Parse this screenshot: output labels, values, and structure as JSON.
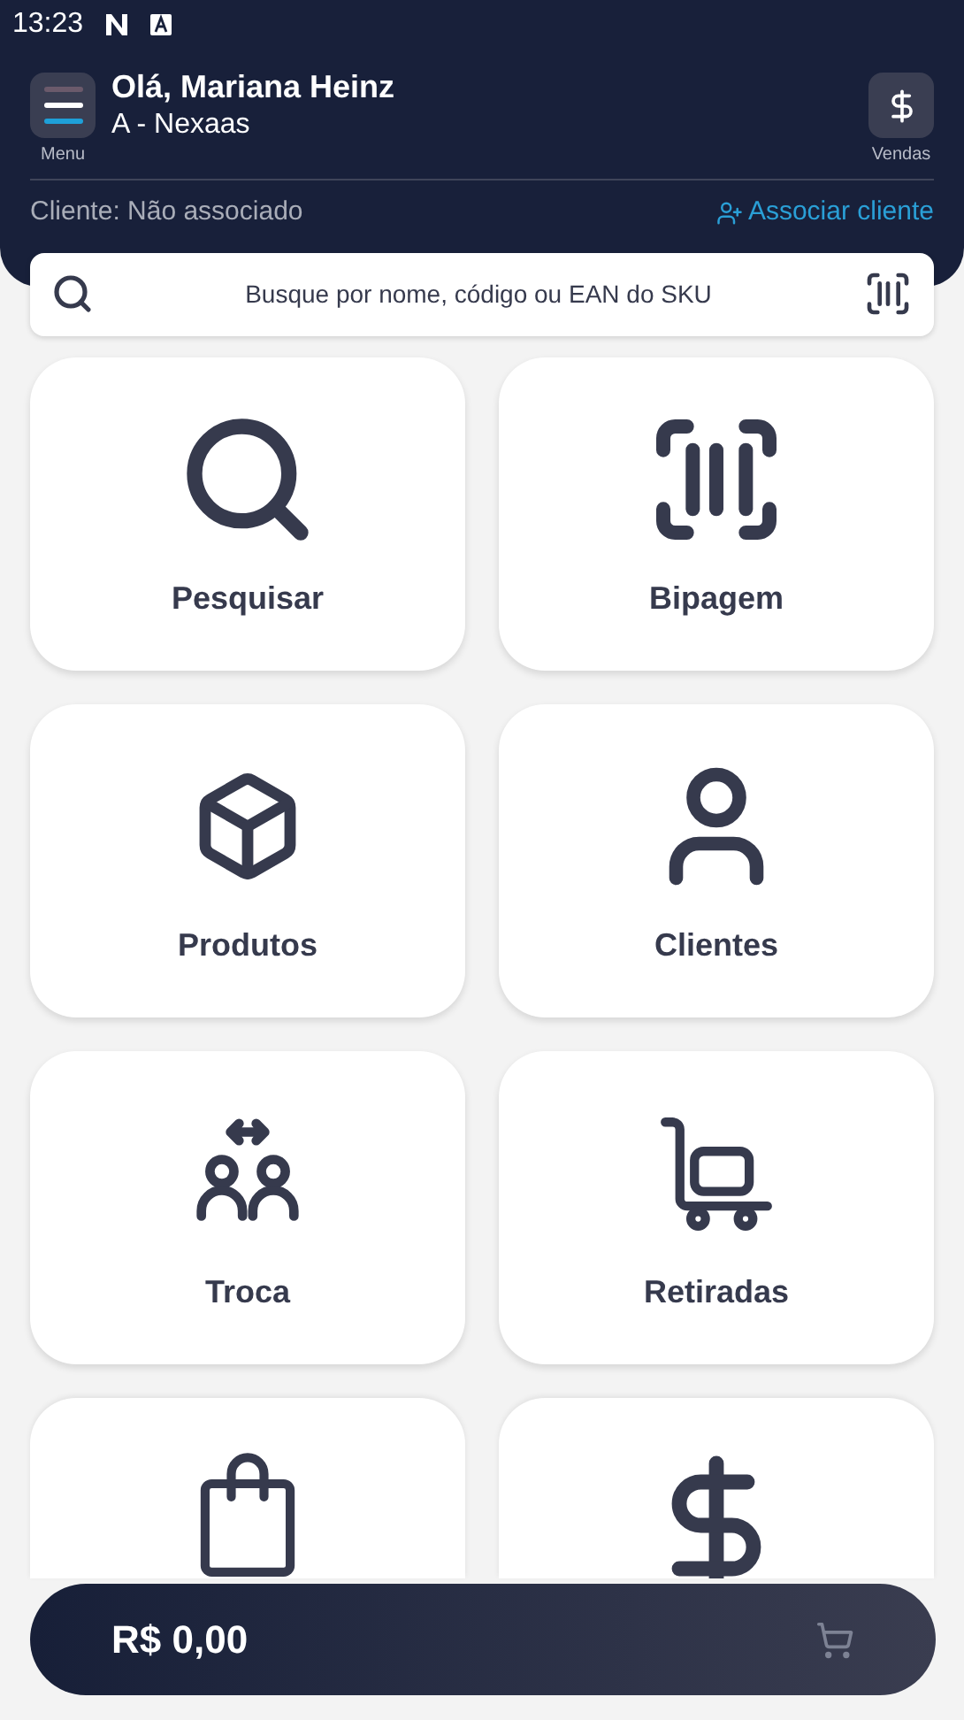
{
  "status_bar": {
    "time": "13:23"
  },
  "header": {
    "menu_label": "Menu",
    "greeting": "Olá, Mariana Heinz",
    "store": "A - Nexaas",
    "sales_label": "Vendas",
    "client_status": "Cliente: Não associado",
    "associate_link": "Associar cliente"
  },
  "search": {
    "placeholder": "Busque por nome, código ou EAN do SKU"
  },
  "tiles": [
    {
      "kind": "search",
      "label": "Pesquisar"
    },
    {
      "kind": "barcode",
      "label": "Bipagem"
    },
    {
      "kind": "box",
      "label": "Produtos"
    },
    {
      "kind": "user",
      "label": "Clientes"
    },
    {
      "kind": "exchange",
      "label": "Troca"
    },
    {
      "kind": "trolley",
      "label": "Retiradas"
    },
    {
      "kind": "bag"
    },
    {
      "kind": "dollar"
    }
  ],
  "cart_bar": {
    "total": "R$ 0,00"
  }
}
